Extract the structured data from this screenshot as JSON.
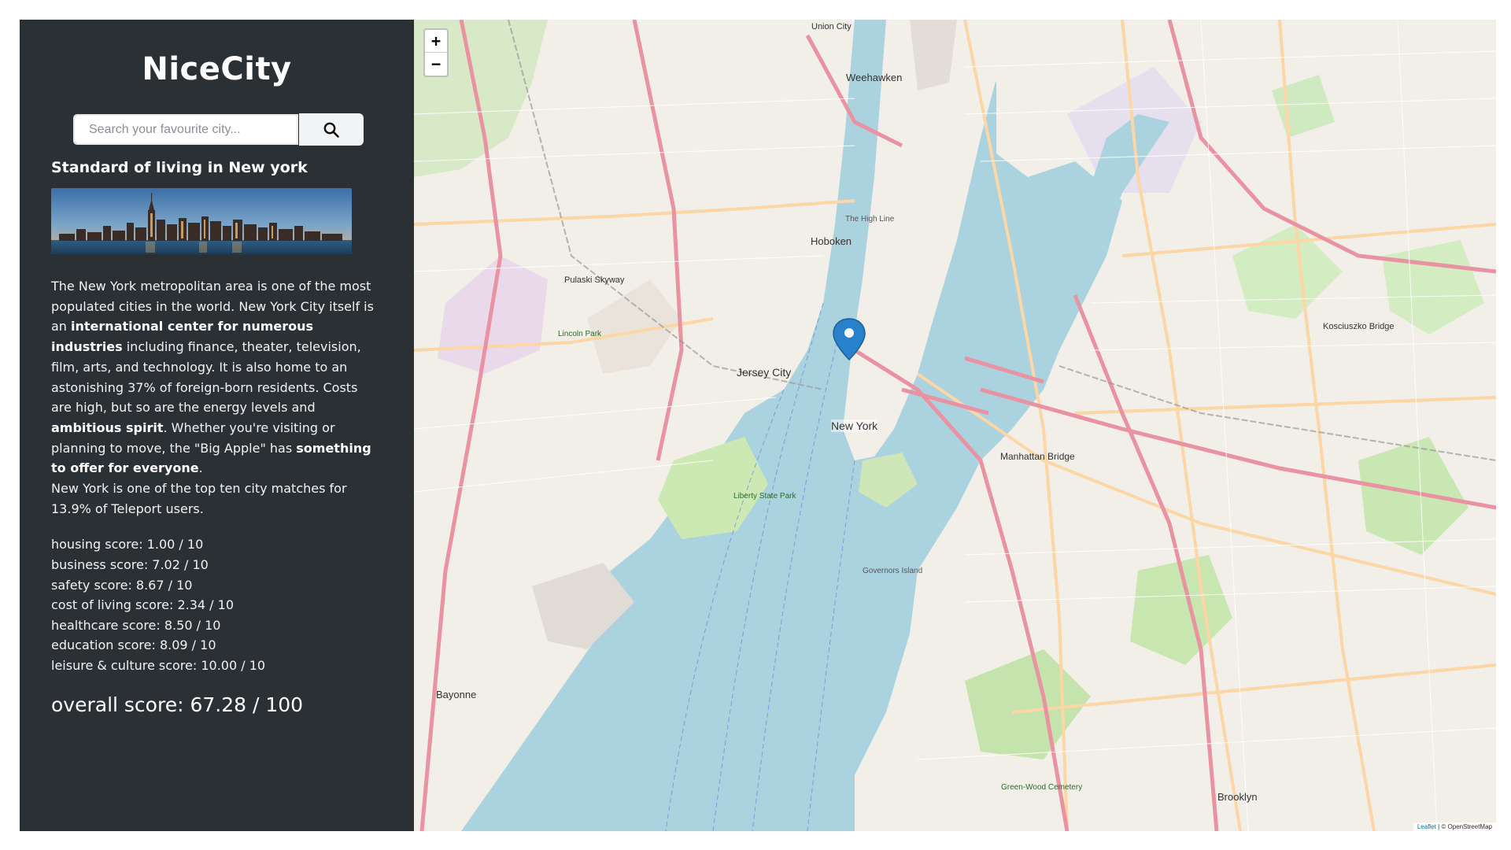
{
  "app": {
    "title": "NiceCity"
  },
  "search": {
    "placeholder": "Search your favourite city...",
    "icon": "search-icon"
  },
  "city": {
    "heading": "Standard of living in New york",
    "description_parts": [
      "The New York metropolitan area is one of the most populated cities in the world. New York City itself is an ",
      "international center for numerous industries",
      " including finance, theater, television, film, arts, and technology. It is also home to an astonishing 37% of foreign-born residents. Costs are high, but so are the energy levels and ",
      "ambitious spirit",
      ". Whether you're visiting or planning to move, the \"Big Apple\" has ",
      "something to offer for everyone",
      "."
    ],
    "teleport_note": "New York is one of the top ten city matches for 13.9% of Teleport users."
  },
  "scores": [
    "housing score: 1.00 / 10",
    "business score: 7.02 / 10",
    "safety score: 8.67 / 10",
    "cost of living score: 2.34 / 10",
    "healthcare score: 8.50 / 10",
    "education score: 8.09 / 10",
    "leisure & culture score: 10.00 / 10"
  ],
  "overall": "overall score: 67.28 / 100",
  "map": {
    "zoom_in": "+",
    "zoom_out": "−",
    "marker_label": "New York",
    "attribution_leaflet": "Leaflet",
    "attribution_rest": " | © OpenStreetMap",
    "labels": {
      "weehawken": "Weehawken",
      "hoboken": "Hoboken",
      "jersey_city": "Jersey City",
      "union_city": "Union City",
      "manhattan_bridge": "Manhattan Bridge",
      "brooklyn": "Brooklyn",
      "bayonne": "Bayonne",
      "governors_island": "Governors Island",
      "liberty_state_park": "Liberty State Park",
      "kosciuszko_bridge": "Kosciuszko Bridge",
      "green_wood": "Green-Wood Cemetery",
      "lincoln_park": "Lincoln Park",
      "pulaski_skyway": "Pulaski Skyway",
      "the_high_line": "The High Line"
    }
  },
  "colors": {
    "sidebar_bg": "#2b3035",
    "water": "#aad3df",
    "marker": "#2a81cb"
  }
}
